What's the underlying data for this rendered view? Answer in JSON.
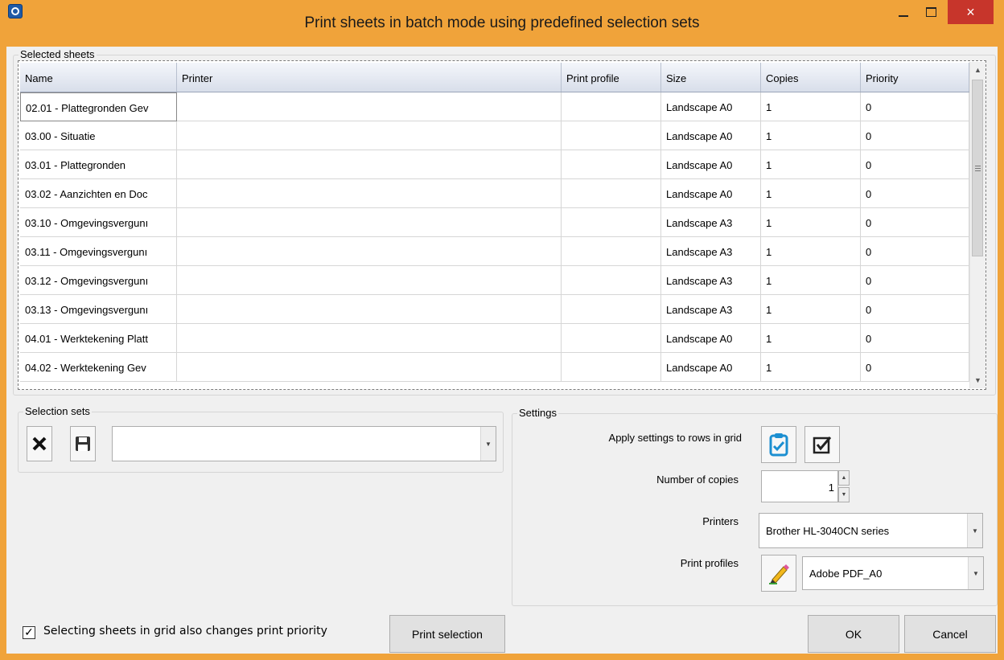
{
  "window": {
    "title": "Print sheets in batch mode using predefined selection sets",
    "minimize_icon": "minimize-icon",
    "maximize_icon": "maximize-icon",
    "close_glyph": "×"
  },
  "selected_sheets": {
    "group_label": "Selected sheets",
    "columns": [
      "Name",
      "Printer",
      "Print profile",
      "Size",
      "Copies",
      "Priority"
    ],
    "rows": [
      {
        "name": "02.01 - Plattegronden Gev",
        "printer": "",
        "profile": "",
        "size": "Landscape A0",
        "copies": "1",
        "priority": "0"
      },
      {
        "name": "03.00 - Situatie",
        "printer": "",
        "profile": "",
        "size": "Landscape A0",
        "copies": "1",
        "priority": "0"
      },
      {
        "name": "03.01 - Plattegronden",
        "printer": "",
        "profile": "",
        "size": "Landscape A0",
        "copies": "1",
        "priority": "0"
      },
      {
        "name": "03.02 - Aanzichten en Doc",
        "printer": "",
        "profile": "",
        "size": "Landscape A0",
        "copies": "1",
        "priority": "0"
      },
      {
        "name": "03.10 - Omgevingsvergunı",
        "printer": "",
        "profile": "",
        "size": "Landscape A3",
        "copies": "1",
        "priority": "0"
      },
      {
        "name": "03.11 - Omgevingsvergunı",
        "printer": "",
        "profile": "",
        "size": "Landscape A3",
        "copies": "1",
        "priority": "0"
      },
      {
        "name": "03.12 - Omgevingsvergunı",
        "printer": "",
        "profile": "",
        "size": "Landscape A3",
        "copies": "1",
        "priority": "0"
      },
      {
        "name": "03.13 - Omgevingsvergunı",
        "printer": "",
        "profile": "",
        "size": "Landscape A3",
        "copies": "1",
        "priority": "0"
      },
      {
        "name": "04.01 - Werktekening Platt",
        "printer": "",
        "profile": "",
        "size": "Landscape A0",
        "copies": "1",
        "priority": "0"
      },
      {
        "name": "04.02 - Werktekening Gev",
        "printer": "",
        "profile": "",
        "size": "Landscape A0",
        "copies": "1",
        "priority": "0"
      }
    ]
  },
  "selection_sets": {
    "group_label": "Selection sets",
    "delete_icon": "delete-x-icon",
    "save_icon": "save-disk-icon",
    "current_value": ""
  },
  "settings": {
    "group_label": "Settings",
    "apply_label": "Apply settings to rows in grid",
    "apply_clipboard_icon": "clipboard-check-icon",
    "apply_checkbox_icon": "checkbox-check-icon",
    "copies_label": "Number of copies",
    "copies_value": "1",
    "printers_label": "Printers",
    "printer_value": "Brother HL-3040CN series",
    "profiles_label": "Print profiles",
    "profile_edit_icon": "pencil-edit-icon",
    "profile_value": "Adobe PDF_A0"
  },
  "footer": {
    "checkbox_label": "Selecting sheets in grid also changes print priority",
    "checkbox_checked": true,
    "check_glyph": "✓",
    "print_selection": "Print selection",
    "ok": "OK",
    "cancel": "Cancel"
  },
  "colors": {
    "title_bar": "#f0a33a",
    "close_button": "#c7352b",
    "dialog_background": "#f0f0f0",
    "icon_blue": "#1c8fd1"
  }
}
